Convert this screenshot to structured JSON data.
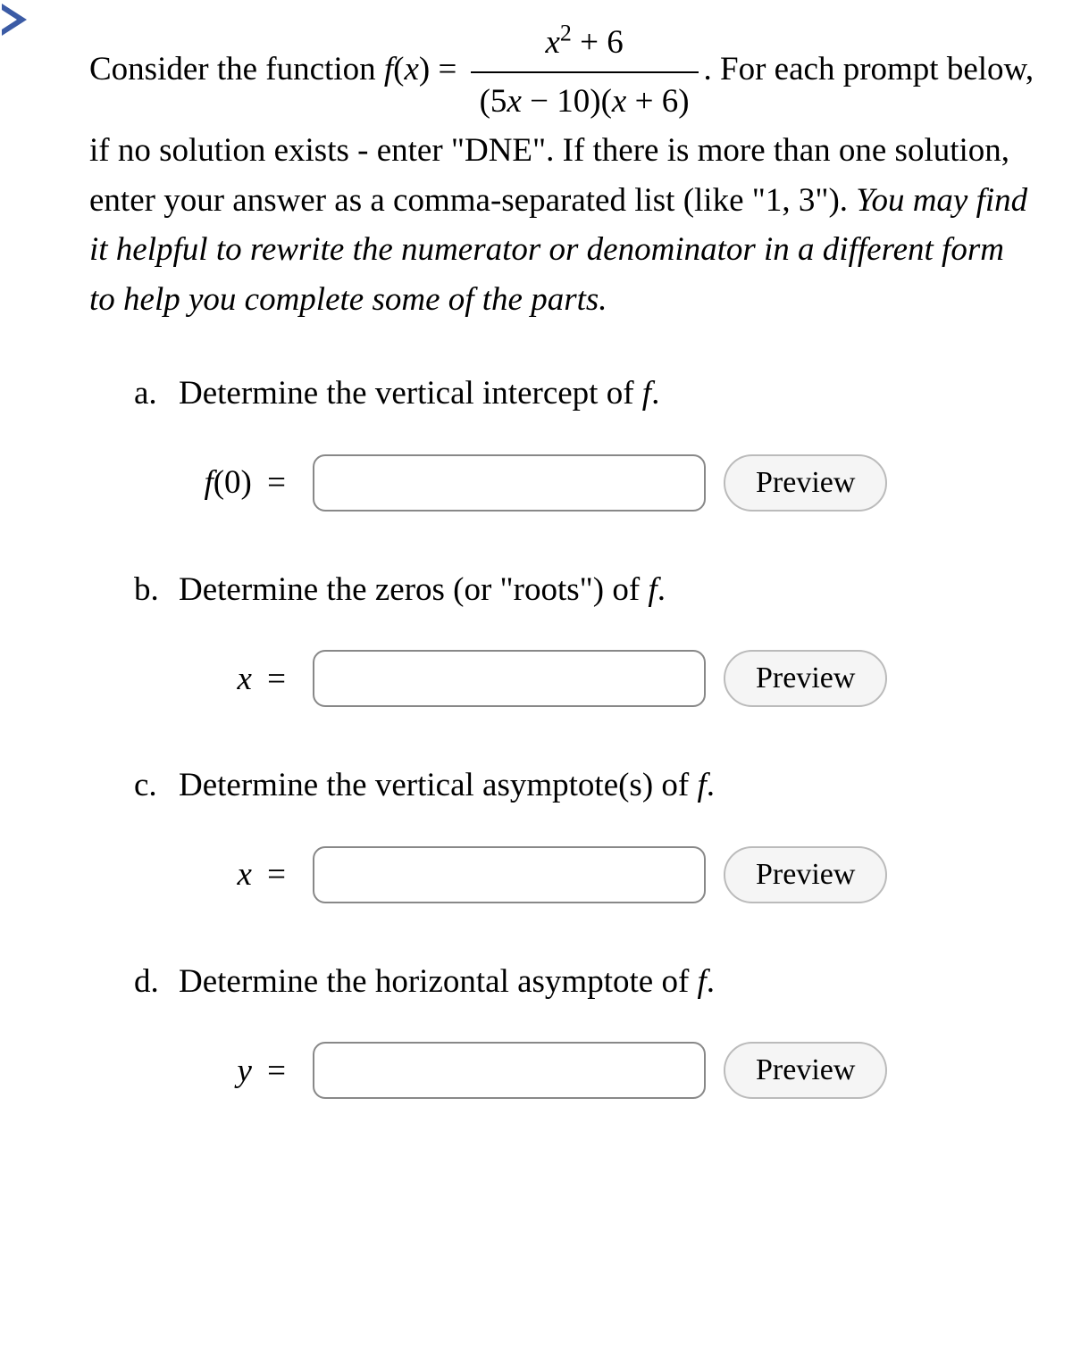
{
  "marker": {
    "name": "expand-marker"
  },
  "intro": {
    "prefix": "Consider the function ",
    "fn_name": "f",
    "fn_arg": "x",
    "eq": " = ",
    "numerator_var": "x",
    "numerator_exp": "2",
    "numerator_rest": " + 6",
    "denom_a": "(5",
    "denom_var1": "x",
    "denom_b": " − 10)(",
    "denom_var2": "x",
    "denom_c": " + 6)",
    "suffix1": ". For each prompt below, if no solution exists - enter \"DNE\". If there is more than one solution, enter your answer as a comma-separated list (like \"1, 3\"). ",
    "hint": "You may find it helpful to rewrite the numerator or denominator in a different form to help you complete some of the parts."
  },
  "prompts": [
    {
      "letter": "a.",
      "text_before": "Determine the vertical intercept of ",
      "fn": "f",
      "text_after": ".",
      "label_fn": "f",
      "label_arg": "(0)",
      "label_eq": " =",
      "preview": "Preview"
    },
    {
      "letter": "b.",
      "text_before": "Determine the zeros (or \"roots\") of ",
      "fn": "f",
      "text_after": ".",
      "label_var": "x",
      "label_eq": " =",
      "preview": "Preview"
    },
    {
      "letter": "c.",
      "text_before": "Determine the vertical asymptote(s) of ",
      "fn": "f",
      "text_after": ".",
      "label_var": "x",
      "label_eq": " =",
      "preview": "Preview"
    },
    {
      "letter": "d.",
      "text_before": "Determine the horizontal asymptote of ",
      "fn": "f",
      "text_after": ".",
      "label_var": "y",
      "label_eq": " =",
      "preview": "Preview"
    }
  ]
}
